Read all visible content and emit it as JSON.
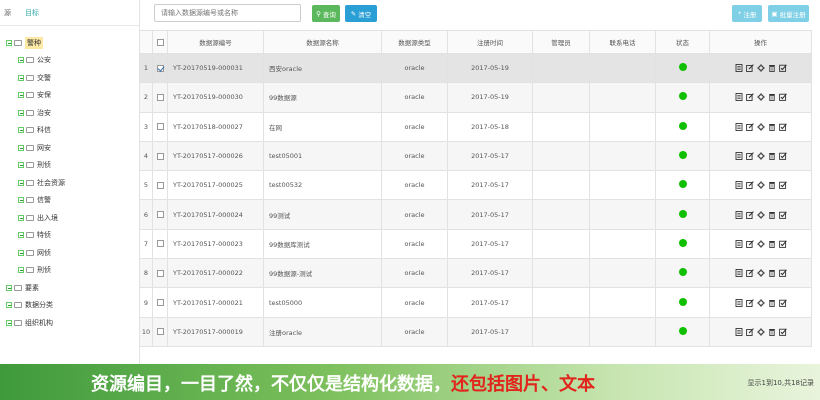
{
  "sidebar": {
    "tabs": [
      "源",
      "目标"
    ],
    "tree": [
      {
        "label": "警种",
        "level": 0,
        "selected": true,
        "folder": true
      },
      {
        "label": "公安",
        "level": 1
      },
      {
        "label": "交警",
        "level": 1
      },
      {
        "label": "安保",
        "level": 1
      },
      {
        "label": "治安",
        "level": 1
      },
      {
        "label": "科信",
        "level": 1
      },
      {
        "label": "网安",
        "level": 1
      },
      {
        "label": "刑侦",
        "level": 1
      },
      {
        "label": "社会资源",
        "level": 1
      },
      {
        "label": "信警",
        "level": 1
      },
      {
        "label": "出入境",
        "level": 1
      },
      {
        "label": "特侦",
        "level": 1
      },
      {
        "label": "网侦",
        "level": 1
      },
      {
        "label": "刑侦",
        "level": 1
      },
      {
        "label": "要素",
        "level": 0
      },
      {
        "label": "数据分类",
        "level": 0
      },
      {
        "label": "组织机构",
        "level": 0
      }
    ]
  },
  "toolbar": {
    "search_placeholder": "请输入数据源编号或名称",
    "query_label": "查询",
    "clear_label": "清空",
    "register_label": "注册",
    "batch_label": "批量注册"
  },
  "table": {
    "headers": [
      "",
      "",
      "数据源编号",
      "数据源名称",
      "数据源类型",
      "注册时间",
      "管理员",
      "联系电话",
      "状态",
      "操作"
    ],
    "rows": [
      {
        "n": "1",
        "code": "YT-20170519-000031",
        "name": "西安oracle",
        "type": "oracle",
        "date": "2017-05-19",
        "checked": true
      },
      {
        "n": "2",
        "code": "YT-20170519-000030",
        "name": "99数据源",
        "type": "oracle",
        "date": "2017-05-19",
        "checked": false
      },
      {
        "n": "3",
        "code": "YT-20170518-000027",
        "name": "在网",
        "type": "oracle",
        "date": "2017-05-18",
        "checked": false
      },
      {
        "n": "4",
        "code": "YT-20170517-000026",
        "name": "test05001",
        "type": "oracle",
        "date": "2017-05-17",
        "checked": false
      },
      {
        "n": "5",
        "code": "YT-20170517-000025",
        "name": "test00532",
        "type": "oracle",
        "date": "2017-05-17",
        "checked": false
      },
      {
        "n": "6",
        "code": "YT-20170517-000024",
        "name": "99测试",
        "type": "oracle",
        "date": "2017-05-17",
        "checked": false
      },
      {
        "n": "7",
        "code": "YT-20170517-000023",
        "name": "99数据库测试",
        "type": "oracle",
        "date": "2017-05-17",
        "checked": false
      },
      {
        "n": "8",
        "code": "YT-20170517-000022",
        "name": "99数据源-测试",
        "type": "oracle",
        "date": "2017-05-17",
        "checked": false
      },
      {
        "n": "9",
        "code": "YT-20170517-000021",
        "name": "test05000",
        "type": "oracle",
        "date": "2017-05-17",
        "checked": false
      },
      {
        "n": "10",
        "code": "YT-20170517-000019",
        "name": "注册oracle",
        "type": "oracle",
        "date": "2017-05-17",
        "checked": false
      }
    ],
    "status_color": "#10c000"
  },
  "banner": {
    "text_main": "资源编目，一目了然，不仅仅是结构化数据，",
    "text_red": "还包括图片、文本",
    "pager": "显示1到10,共18记录"
  }
}
